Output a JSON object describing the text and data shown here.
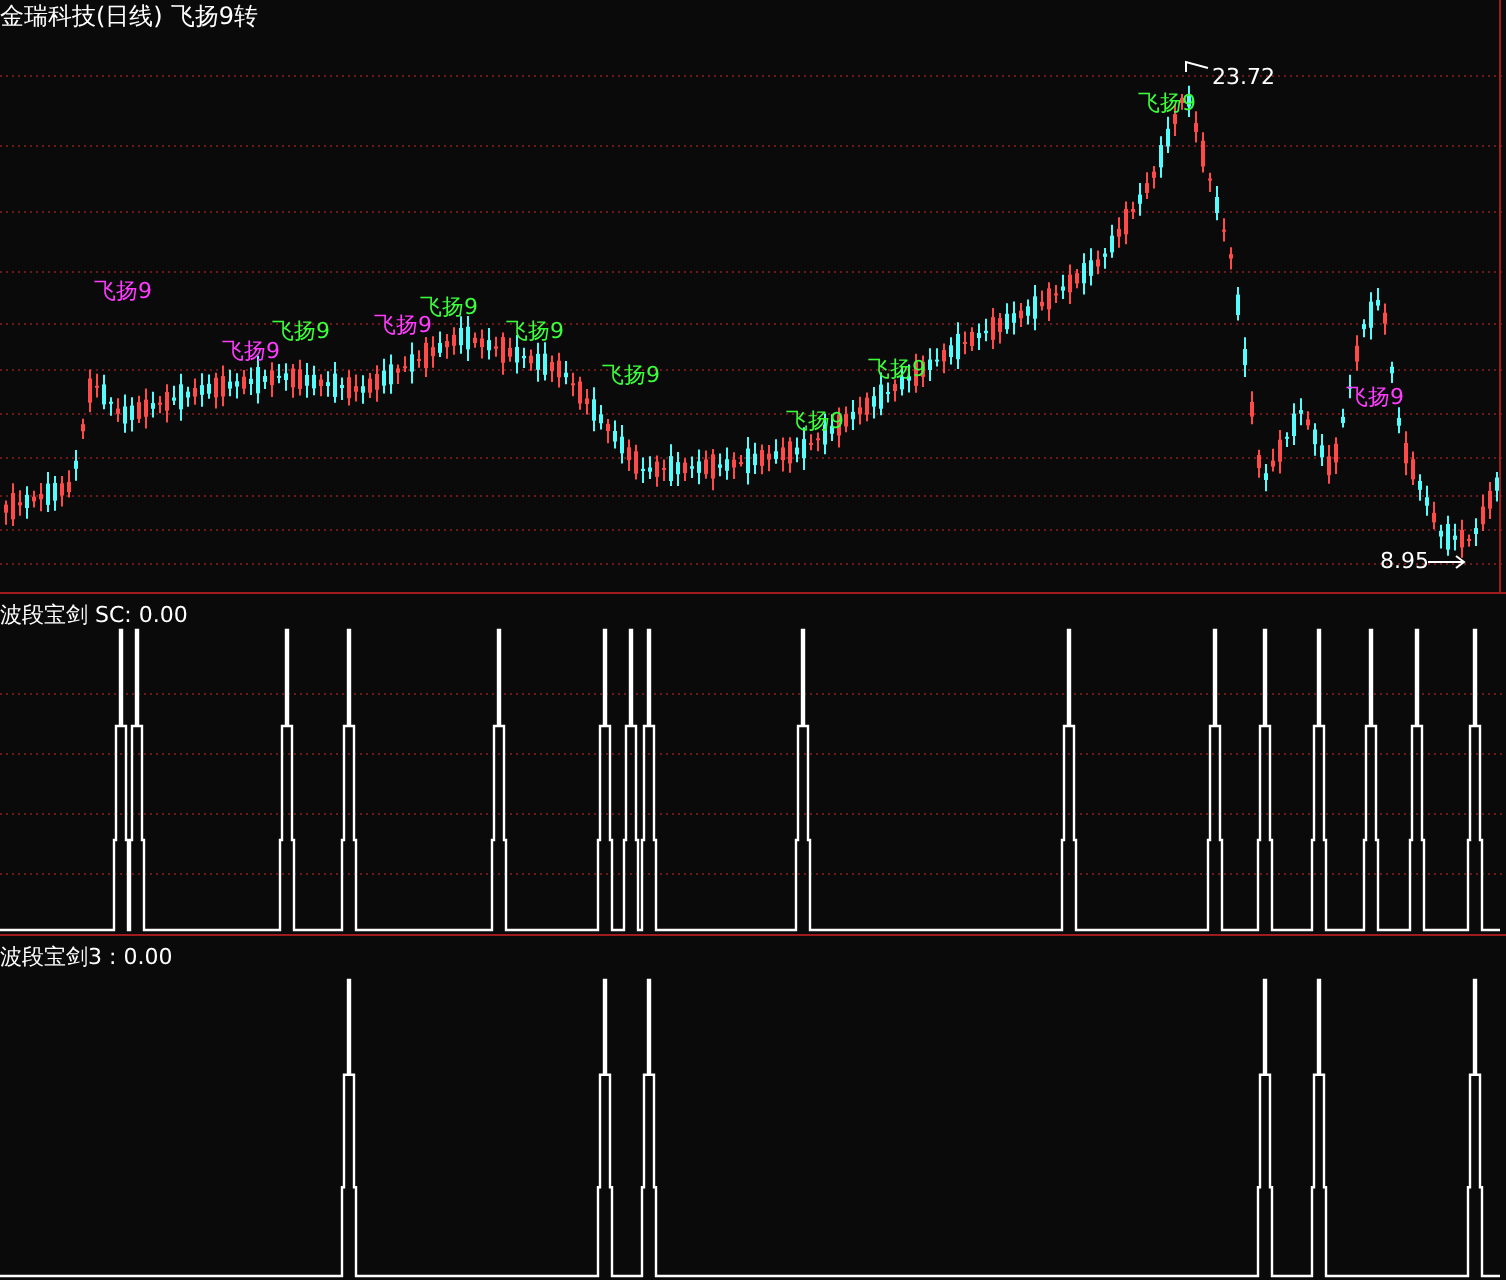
{
  "header": {
    "stock": "金瑞科技(日线)",
    "indicator": "飞扬9转"
  },
  "main_chart": {
    "high_label": "23.72",
    "low_label": "8.95",
    "signals": [
      {
        "text": "飞扬9",
        "color": "#ff3cff"
      },
      {
        "text": "飞扬9",
        "color": "#ff3cff"
      },
      {
        "text": "飞扬9",
        "color": "#3cff3c"
      },
      {
        "text": "飞扬9",
        "color": "#ff3cff"
      },
      {
        "text": "飞扬9",
        "color": "#3cff3c"
      },
      {
        "text": "飞扬9",
        "color": "#3cff3c"
      },
      {
        "text": "飞扬9",
        "color": "#3cff3c"
      },
      {
        "text": "飞扬9",
        "color": "#3cff3c"
      },
      {
        "text": "飞扬9",
        "color": "#3cff3c"
      },
      {
        "text": "飞扬9",
        "color": "#3cff3c"
      },
      {
        "text": "飞扬9",
        "color": "#ff3cff"
      }
    ]
  },
  "panels": [
    {
      "title": "波段宝剑 SC: 0.00"
    },
    {
      "title": "波段宝剑3 : 0.00"
    }
  ]
}
